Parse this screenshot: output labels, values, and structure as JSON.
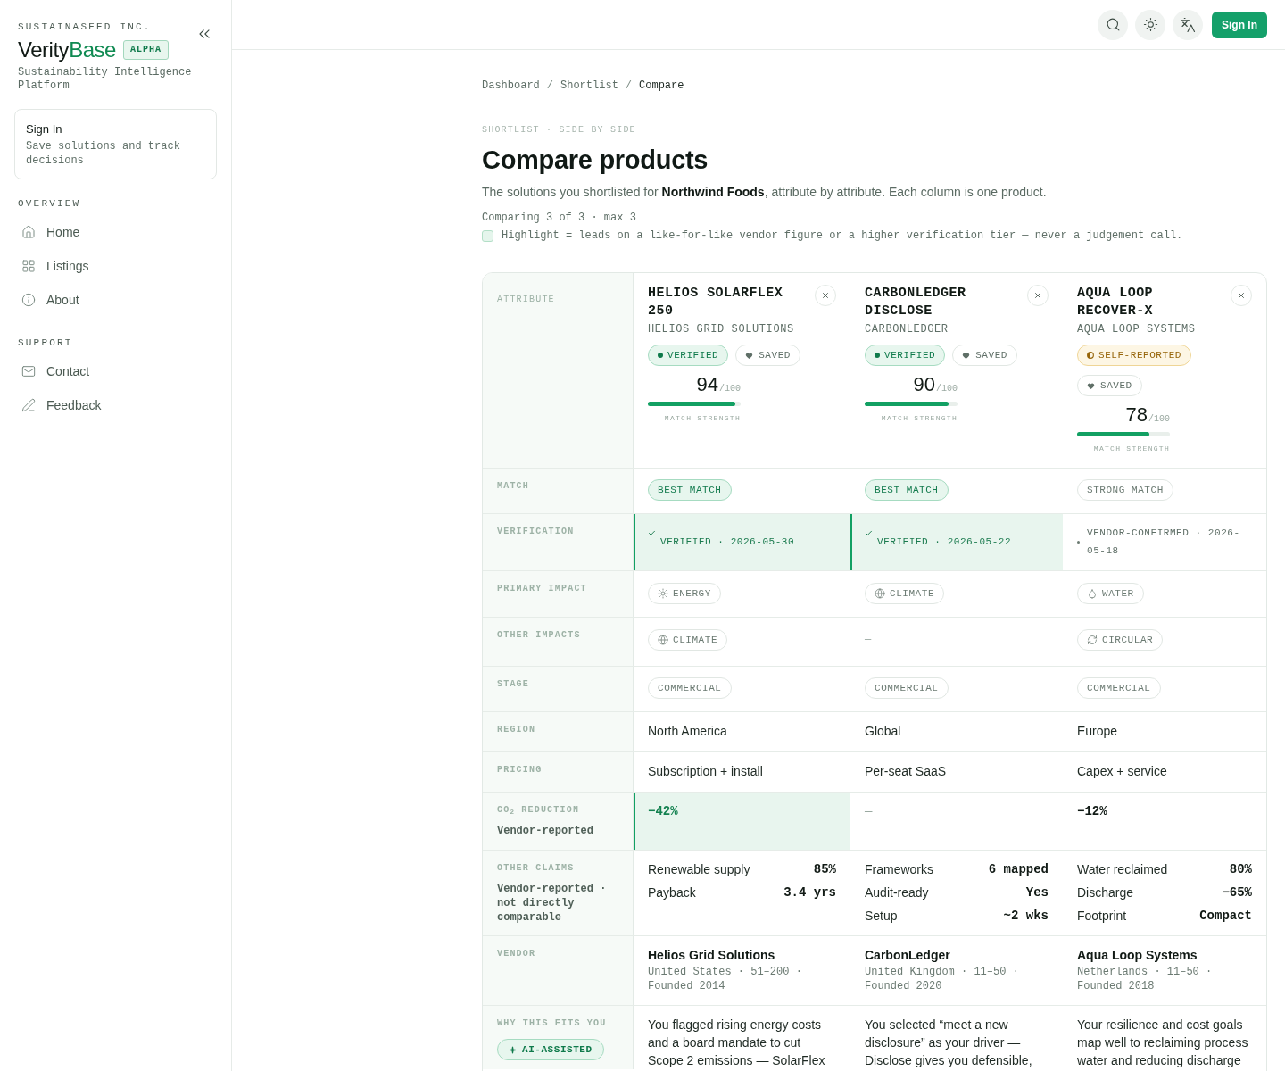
{
  "sidebar": {
    "company": "SUSTAINASEED INC.",
    "brand": {
      "lead": "Verity",
      "accent": "Base"
    },
    "badge": "ALPHA",
    "tagline": "Sustainability Intelligence Platform",
    "sign_in_card": {
      "title": "Sign In",
      "text": "Save solutions and track decisions"
    },
    "sections": [
      {
        "heading": "OVERVIEW",
        "items": [
          {
            "label": "Home"
          },
          {
            "label": "Listings"
          },
          {
            "label": "About"
          }
        ]
      },
      {
        "heading": "SUPPORT",
        "items": [
          {
            "label": "Contact"
          },
          {
            "label": "Feedback"
          }
        ]
      }
    ]
  },
  "top_bar": {
    "sign_in": "Sign In"
  },
  "breadcrumbs": [
    {
      "label": "Dashboard",
      "current": false
    },
    {
      "separator": "/",
      "label": "Shortlist",
      "current": false
    },
    {
      "separator": "/",
      "label": "Compare",
      "current": true
    }
  ],
  "page": {
    "eyebrow": "SHORTLIST · SIDE BY SIDE",
    "title": "Compare products",
    "description": "The solutions you shortlisted for **Northwind Foods**, attribute by attribute. Each column is one product.",
    "count": "Comparing 3 of 3 · max 3",
    "legend": "Highlight = leads on a like-for-like vendor figure or a higher verification tier — never a judgement call."
  },
  "comparison": {
    "attribute_heading": "ATTRIBUTE",
    "products": [
      {
        "name": "HELIOS SOLARFLEX 250",
        "vendor": "HELIOS GRID SOLUTIONS",
        "verification": {
          "kind": "verified",
          "label": "VERIFIED"
        },
        "saved": true,
        "saved_label": "SAVED",
        "score": "94",
        "score_scale": "/100",
        "level": 0.94,
        "score_caption": "MATCH STRENGTH"
      },
      {
        "name": "CARBONLEDGER DISCLOSE",
        "vendor": "CARBONLEDGER",
        "verification": {
          "kind": "verified",
          "label": "VERIFIED"
        },
        "saved": true,
        "saved_label": "SAVED",
        "score": "90",
        "score_scale": "/100",
        "level": 0.9,
        "score_caption": "MATCH STRENGTH"
      },
      {
        "name": "AQUA LOOP RECOVER-X",
        "vendor": "AQUA LOOP SYSTEMS",
        "verification": {
          "kind": "self_reported",
          "label": "SELF-REPORTED"
        },
        "saved": true,
        "saved_label": "SAVED",
        "score": "78",
        "score_scale": "/100",
        "level": 0.78,
        "score_caption": "MATCH STRENGTH"
      }
    ],
    "rows": [
      {
        "kind": "chip",
        "label": "MATCH",
        "cells": [
          {
            "text": "BEST MATCH",
            "highlighted": true
          },
          {
            "text": "BEST MATCH",
            "highlighted": true
          },
          {
            "text": "STRONG MATCH",
            "highlighted": false
          }
        ]
      },
      {
        "kind": "verification",
        "label": "VERIFICATION",
        "cells": [
          {
            "kind": "verified",
            "text": "VERIFIED · 2026-05-30",
            "highlighted": true
          },
          {
            "kind": "verified",
            "text": "VERIFIED · 2026-05-22",
            "highlighted": true
          },
          {
            "kind": "vendor_confirmed",
            "text": "VENDOR-CONFIRMED · 2026-05-18",
            "highlighted": false
          }
        ]
      },
      {
        "kind": "impact",
        "label": "PRIMARY IMPACT",
        "cells": [
          {
            "kind": "energy",
            "text": "ENERGY"
          },
          {
            "kind": "climate",
            "text": "CLIMATE"
          },
          {
            "kind": "water",
            "text": "WATER"
          }
        ]
      },
      {
        "kind": "impact",
        "label": "OTHER IMPACTS",
        "cells": [
          {
            "kind": "climate",
            "text": "CLIMATE"
          },
          {
            "kind": "none",
            "text": "—"
          },
          {
            "kind": "circular",
            "text": "CIRCULAR"
          }
        ]
      },
      {
        "kind": "chip",
        "label": "STAGE",
        "cells": [
          {
            "text": "COMMERCIAL"
          },
          {
            "text": "COMMERCIAL"
          },
          {
            "text": "COMMERCIAL"
          }
        ]
      },
      {
        "kind": "text",
        "label": "REGION",
        "cells": [
          {
            "text": "North America"
          },
          {
            "text": "Global"
          },
          {
            "text": "Europe"
          }
        ]
      },
      {
        "kind": "text",
        "label": "PRICING",
        "cells": [
          {
            "text": "Subscription + install"
          },
          {
            "text": "Per-seat SaaS"
          },
          {
            "text": "Capex + service"
          }
        ]
      },
      {
        "kind": "metric",
        "label": "CO$_{2}$ REDUCTION",
        "note": "Vendor-reported",
        "cells": [
          {
            "kind": "value",
            "text": "−42%",
            "highlighted": true
          },
          {
            "kind": "none",
            "text": "—",
            "highlighted": false
          },
          {
            "kind": "value",
            "text": "−12%",
            "highlighted": false
          }
        ]
      },
      {
        "kind": "claims",
        "label": "OTHER CLAIMS",
        "note": "Vendor-reported · not directly comparable",
        "cells": [
          {
            "items": [
              {
                "label": "Renewable supply",
                "value": "85%"
              },
              {
                "label": "Payback",
                "value": "3.4 yrs"
              }
            ]
          },
          {
            "items": [
              {
                "label": "Frameworks",
                "value": "6 mapped"
              },
              {
                "label": "Audit-ready",
                "value": "Yes"
              },
              {
                "label": "Setup",
                "value": "~2 wks"
              }
            ]
          },
          {
            "items": [
              {
                "label": "Water reclaimed",
                "value": "80%"
              },
              {
                "label": "Discharge",
                "value": "−65%"
              },
              {
                "label": "Footprint",
                "value": "Compact"
              }
            ]
          }
        ]
      },
      {
        "kind": "vendor",
        "label": "VENDOR",
        "cells": [
          {
            "name": "Helios Grid Solutions",
            "details": "United States · 51–200 · Founded 2014"
          },
          {
            "name": "CarbonLedger",
            "details": "United Kingdom · 11–50 · Founded 2020"
          },
          {
            "name": "Aqua Loop Systems",
            "details": "Netherlands · 11–50 · Founded 2018"
          }
        ]
      },
      {
        "kind": "rationale",
        "label": "WHY THIS FITS YOU",
        "badge": "AI-ASSISTED",
        "cells": [
          {
            "text": "You flagged rising energy costs and a board mandate to cut Scope 2 emissions — SolarFlex"
          },
          {
            "text": "You selected “meet a new disclosure” as your driver — Disclose gives you defensible,"
          },
          {
            "text": "Your resilience and cost goals map well to reclaiming process water and reducing discharge"
          }
        ]
      }
    ]
  }
}
